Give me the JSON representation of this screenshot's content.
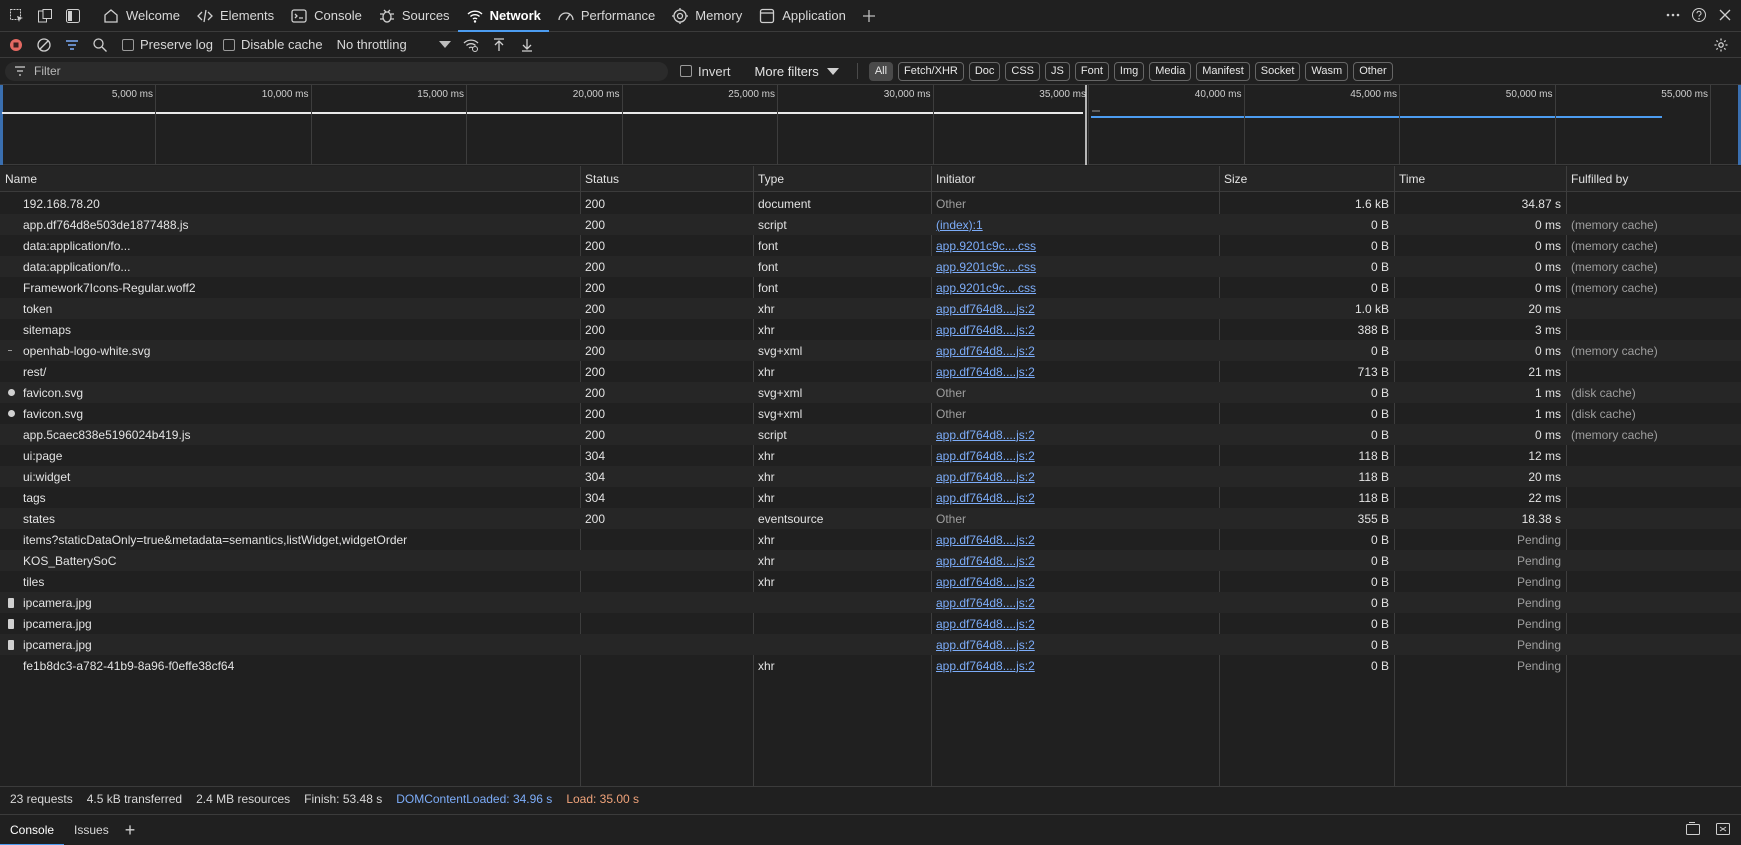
{
  "tabs": [
    {
      "label": "Welcome",
      "icon": "home-icon"
    },
    {
      "label": "Elements",
      "icon": "code-icon"
    },
    {
      "label": "Console",
      "icon": "console-icon"
    },
    {
      "label": "Sources",
      "icon": "bug-icon"
    },
    {
      "label": "Network",
      "icon": "wifi-icon",
      "active": true
    },
    {
      "label": "Performance",
      "icon": "gauge-icon"
    },
    {
      "label": "Memory",
      "icon": "chip-icon"
    },
    {
      "label": "Application",
      "icon": "app-icon"
    }
  ],
  "toolbar": {
    "preserve_log": "Preserve log",
    "disable_cache": "Disable cache",
    "throttling": "No throttling"
  },
  "filterbar": {
    "placeholder": "Filter",
    "invert": "Invert",
    "more_filters": "More filters",
    "chips": [
      "All",
      "Fetch/XHR",
      "Doc",
      "CSS",
      "JS",
      "Font",
      "Img",
      "Media",
      "Manifest",
      "Socket",
      "Wasm",
      "Other"
    ],
    "active_chip": "All"
  },
  "overview": {
    "ticks": [
      "5,000 ms",
      "10,000 ms",
      "15,000 ms",
      "20,000 ms",
      "25,000 ms",
      "30,000 ms",
      "35,000 ms",
      "40,000 ms",
      "45,000 ms",
      "50,000 ms",
      "55,000 ms"
    ]
  },
  "columns": {
    "name": "Name",
    "status": "Status",
    "type": "Type",
    "initiator": "Initiator",
    "size": "Size",
    "time": "Time",
    "fulfilled": "Fulfilled by"
  },
  "requests": [
    {
      "name": "192.168.78.20",
      "status": "200",
      "type": "document",
      "initiator": "Other",
      "size": "1.6 kB",
      "time": "34.87 s",
      "fulfilled": "",
      "icon": "none"
    },
    {
      "name": "app.df764d8e503de1877488.js",
      "status": "200",
      "type": "script",
      "initiator": "(index):1",
      "size": "0 B",
      "time": "0 ms",
      "fulfilled": "(memory cache)",
      "icon": "none"
    },
    {
      "name": "data:application/fo...",
      "status": "200",
      "type": "font",
      "initiator": "app.9201c9c....css",
      "size": "0 B",
      "time": "0 ms",
      "fulfilled": "(memory cache)",
      "icon": "none"
    },
    {
      "name": "data:application/fo...",
      "status": "200",
      "type": "font",
      "initiator": "app.9201c9c....css",
      "size": "0 B",
      "time": "0 ms",
      "fulfilled": "(memory cache)",
      "icon": "none"
    },
    {
      "name": "Framework7Icons-Regular.woff2",
      "status": "200",
      "type": "font",
      "initiator": "app.9201c9c....css",
      "size": "0 B",
      "time": "0 ms",
      "fulfilled": "(memory cache)",
      "icon": "none"
    },
    {
      "name": "token",
      "status": "200",
      "type": "xhr",
      "initiator": "app.df764d8....js:2",
      "size": "1.0 kB",
      "time": "20 ms",
      "fulfilled": "",
      "icon": "none"
    },
    {
      "name": "sitemaps",
      "status": "200",
      "type": "xhr",
      "initiator": "app.df764d8....js:2",
      "size": "388 B",
      "time": "3 ms",
      "fulfilled": "",
      "icon": "none"
    },
    {
      "name": "openhab-logo-white.svg",
      "status": "200",
      "type": "svg+xml",
      "initiator": "app.df764d8....js:2",
      "size": "0 B",
      "time": "0 ms",
      "fulfilled": "(memory cache)",
      "icon": "dash"
    },
    {
      "name": "rest/",
      "status": "200",
      "type": "xhr",
      "initiator": "app.df764d8....js:2",
      "size": "713 B",
      "time": "21 ms",
      "fulfilled": "",
      "icon": "none"
    },
    {
      "name": "favicon.svg",
      "status": "200",
      "type": "svg+xml",
      "initiator": "Other",
      "size": "0 B",
      "time": "1 ms",
      "fulfilled": "(disk cache)",
      "icon": "dot"
    },
    {
      "name": "favicon.svg",
      "status": "200",
      "type": "svg+xml",
      "initiator": "Other",
      "size": "0 B",
      "time": "1 ms",
      "fulfilled": "(disk cache)",
      "icon": "dot"
    },
    {
      "name": "app.5caec838e5196024b419.js",
      "status": "200",
      "type": "script",
      "initiator": "app.df764d8....js:2",
      "size": "0 B",
      "time": "0 ms",
      "fulfilled": "(memory cache)",
      "icon": "none"
    },
    {
      "name": "ui:page",
      "status": "304",
      "type": "xhr",
      "initiator": "app.df764d8....js:2",
      "size": "118 B",
      "time": "12 ms",
      "fulfilled": "",
      "icon": "none"
    },
    {
      "name": "ui:widget",
      "status": "304",
      "type": "xhr",
      "initiator": "app.df764d8....js:2",
      "size": "118 B",
      "time": "20 ms",
      "fulfilled": "",
      "icon": "none"
    },
    {
      "name": "tags",
      "status": "304",
      "type": "xhr",
      "initiator": "app.df764d8....js:2",
      "size": "118 B",
      "time": "22 ms",
      "fulfilled": "",
      "icon": "none"
    },
    {
      "name": "states",
      "status": "200",
      "type": "eventsource",
      "initiator": "Other",
      "size": "355 B",
      "time": "18.38 s",
      "fulfilled": "",
      "icon": "none"
    },
    {
      "name": "items?staticDataOnly=true&metadata=semantics,listWidget,widgetOrder",
      "status": "",
      "type": "xhr",
      "initiator": "app.df764d8....js:2",
      "size": "0 B",
      "time": "Pending",
      "fulfilled": "",
      "icon": "none"
    },
    {
      "name": "KOS_BatterySoC",
      "status": "",
      "type": "xhr",
      "initiator": "app.df764d8....js:2",
      "size": "0 B",
      "time": "Pending",
      "fulfilled": "",
      "icon": "none"
    },
    {
      "name": "tiles",
      "status": "",
      "type": "xhr",
      "initiator": "app.df764d8....js:2",
      "size": "0 B",
      "time": "Pending",
      "fulfilled": "",
      "icon": "none"
    },
    {
      "name": "ipcamera.jpg",
      "status": "",
      "type": "",
      "initiator": "app.df764d8....js:2",
      "size": "0 B",
      "time": "Pending",
      "fulfilled": "",
      "icon": "img"
    },
    {
      "name": "ipcamera.jpg",
      "status": "",
      "type": "",
      "initiator": "app.df764d8....js:2",
      "size": "0 B",
      "time": "Pending",
      "fulfilled": "",
      "icon": "img"
    },
    {
      "name": "ipcamera.jpg",
      "status": "",
      "type": "",
      "initiator": "app.df764d8....js:2",
      "size": "0 B",
      "time": "Pending",
      "fulfilled": "",
      "icon": "img"
    },
    {
      "name": "fe1b8dc3-a782-41b9-8a96-f0effe38cf64",
      "status": "",
      "type": "xhr",
      "initiator": "app.df764d8....js:2",
      "size": "0 B",
      "time": "Pending",
      "fulfilled": "",
      "icon": "none"
    }
  ],
  "status": {
    "requests": "23 requests",
    "transferred": "4.5 kB transferred",
    "resources": "2.4 MB resources",
    "finish": "Finish: 53.48 s",
    "dom": "DOMContentLoaded: 34.96 s",
    "load": "Load: 35.00 s"
  },
  "drawer": {
    "tabs": [
      "Console",
      "Issues"
    ]
  },
  "colors": {
    "accent": "#4c9cf0",
    "link": "#7cacf8",
    "load": "#f0a37a",
    "record": "#e46962"
  }
}
